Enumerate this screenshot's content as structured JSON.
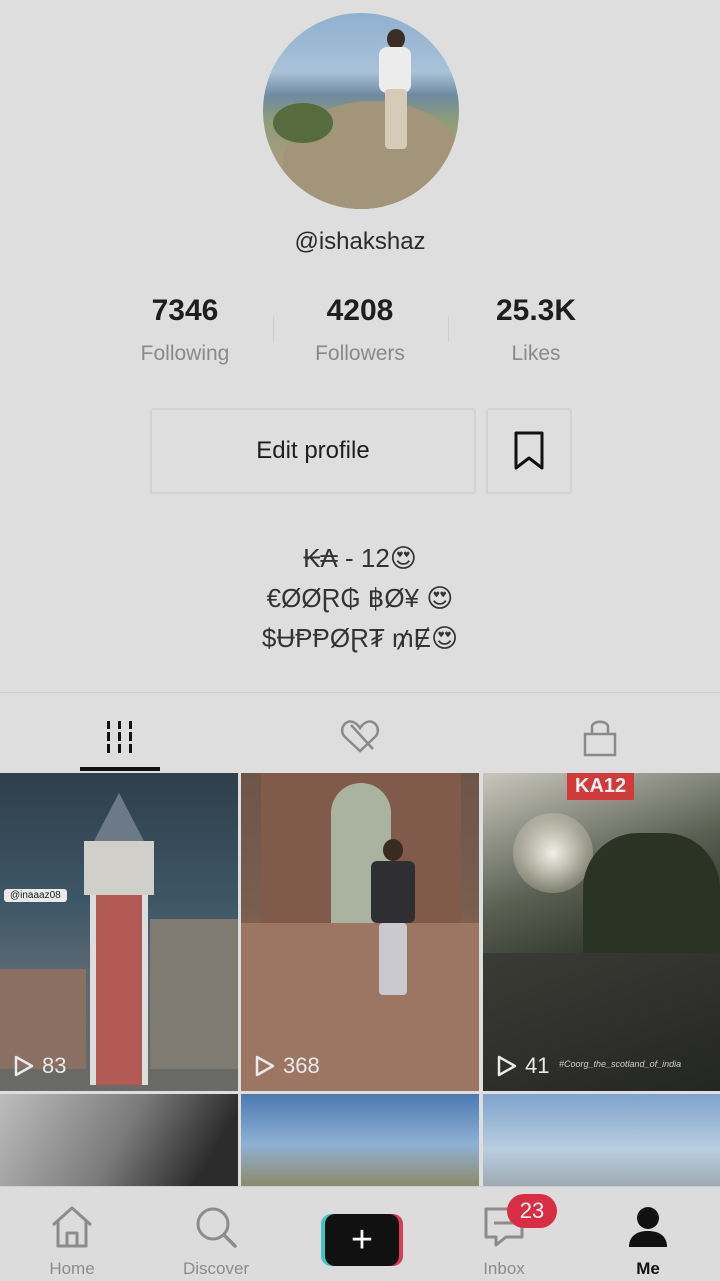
{
  "profile": {
    "username": "@ishakshaz",
    "stats": [
      {
        "value": "7346",
        "label": "Following"
      },
      {
        "value": "4208",
        "label": "Followers"
      },
      {
        "value": "25.3K",
        "label": "Likes"
      }
    ],
    "edit_label": "Edit profile",
    "bio": [
      "₭₳ - 12😍",
      "€ØØⱤ₲ ฿Ø¥ 😍",
      "$ɄⱣⱣØⱤ₮ ₥Ɇ😍"
    ]
  },
  "tabs": [
    {
      "icon": "grid-icon",
      "active": true
    },
    {
      "icon": "liked-hidden-icon",
      "active": false
    },
    {
      "icon": "lock-icon",
      "active": false
    }
  ],
  "videos": [
    {
      "views": "83",
      "tag": "@inaaaz08"
    },
    {
      "views": "368"
    },
    {
      "views": "41",
      "badge": "KA12",
      "caption": "#Coorg_the_scotland_of_india"
    },
    {},
    {},
    {}
  ],
  "nav": {
    "home": "Home",
    "discover": "Discover",
    "inbox": "Inbox",
    "inbox_badge": "23",
    "me": "Me"
  },
  "colors": {
    "accent_red": "#d92d45",
    "accent_cyan": "#40c4c6"
  }
}
